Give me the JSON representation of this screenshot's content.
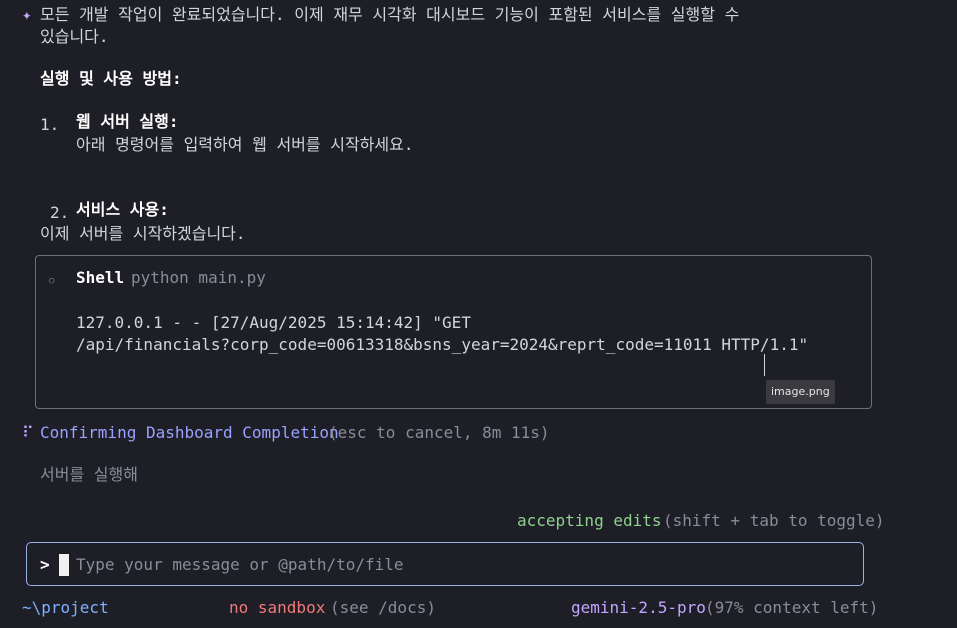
{
  "response": {
    "star": "✦",
    "line1": "모든 개발 작업이 완료되었습니다. 이제 재무 시각화 대시보드 기능이 포함된 서비스를 실행할 수",
    "line2": "있습니다.",
    "howto_heading": "실행 및 사용 방법:",
    "step1_num": "1.",
    "step1_title": "웹 서버 실행:",
    "step1_desc": "아래 명령어를 입력하여 웹 서버를 시작하세요.",
    "step2_num": "2.",
    "step2_title": "서비스 사용:",
    "starting_server": "이제 서버를 시작하겠습니다."
  },
  "shell": {
    "status_icon": "○",
    "label": "Shell",
    "command": "python main.py",
    "log_line1": "127.0.0.1 - - [27/Aug/2025 15:14:42] \"GET",
    "log_line2": "/api/financials?corp_code=00613318&bsns_year=2024&reprt_code=11011 HTTP/1.1\""
  },
  "tooltip": "image.png",
  "status": {
    "spinner": "⠏",
    "title": "Confirming Dashboard Completion",
    "detail": "(esc to cancel, 8m 11s)"
  },
  "queued_message": "서버를 실행해",
  "mode": {
    "label": "accepting edits",
    "hint": "(shift + tab to toggle)"
  },
  "input": {
    "prompt": ">",
    "placeholder": "Type your message or @path/to/file"
  },
  "footer": {
    "cwd": "~\\project",
    "sandbox": "no sandbox",
    "sandbox_hint": "(see /docs)",
    "model": "gemini-2.5-pro",
    "context": "(97% context left)"
  },
  "colors": {
    "background": "#1e1e26",
    "accent_purple": "#c3a6ff",
    "accent_green": "#8fd18f",
    "accent_red": "#f07a7a",
    "input_border": "#9ab0e8"
  }
}
